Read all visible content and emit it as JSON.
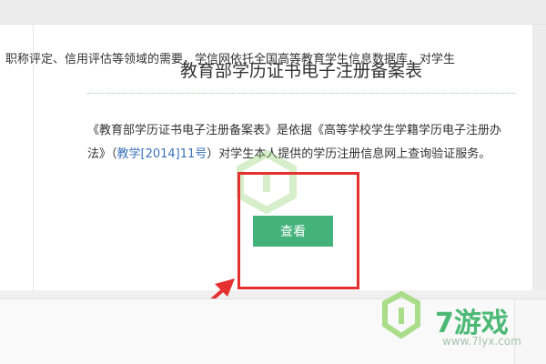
{
  "record": {
    "title": "教育部学历证书电子注册备案表",
    "description_pre": "《教育部学历证书电子注册备案表》是依据《高等学校学生学籍学历电子注册办法》（",
    "description_link": "教学[2014]11号",
    "description_post": "）对学生本人提供的学历注册信息网上查询验证服务。",
    "view_button": "查看"
  },
  "lower_section": {
    "text": "职称评定、信用评估等领域的需要，学信网依托全国高等教育学生信息数据库，对学生"
  },
  "watermark": {
    "brand": "7游戏",
    "url": "www.7lyx.com"
  },
  "colors": {
    "accent_green": "#43b27b",
    "highlight_red": "#e53030",
    "link_blue": "#3a72b8"
  }
}
